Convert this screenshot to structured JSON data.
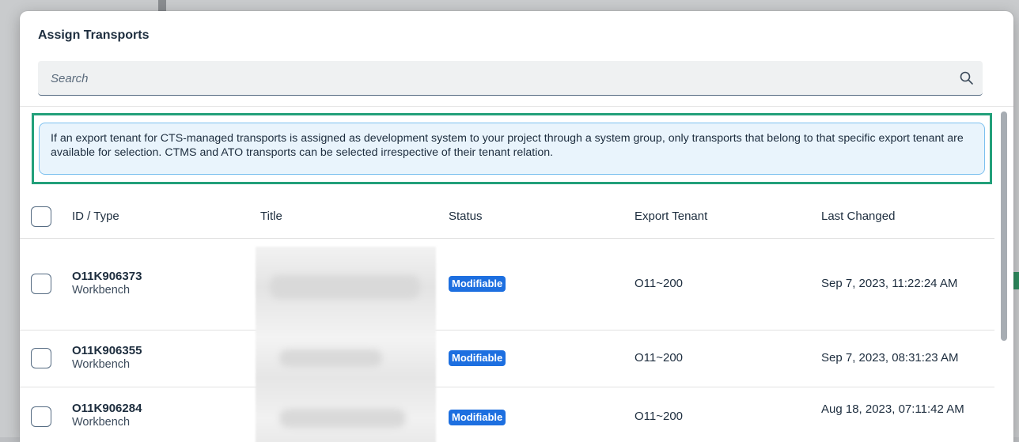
{
  "dialog": {
    "title": "Assign Transports",
    "search_placeholder": "Search"
  },
  "info": {
    "message": "If an export tenant for CTS-managed transports is assigned as development system to your project through a system group, only transports that belong to that specific export tenant are available for selection. CTMS and ATO transports can be selected irrespective of their tenant relation."
  },
  "table": {
    "columns": {
      "id_type": "ID / Type",
      "title": "Title",
      "status": "Status",
      "export_tenant": "Export Tenant",
      "last_changed": "Last Changed"
    },
    "rows": [
      {
        "id": "O11K906373",
        "type": "Workbench",
        "status": "Modifiable",
        "tenant": "O11~200",
        "changed": "Sep 7, 2023, 11:22:24 AM"
      },
      {
        "id": "O11K906355",
        "type": "Workbench",
        "status": "Modifiable",
        "tenant": "O11~200",
        "changed": "Sep 7, 2023, 08:31:23 AM"
      },
      {
        "id": "O11K906284",
        "type": "Workbench",
        "status": "Modifiable",
        "tenant": "O11~200",
        "changed": "Aug 18, 2023, 07:11:42 AM"
      }
    ]
  },
  "colors": {
    "badge": "#1d6fe0",
    "highlight_frame": "#22a07a",
    "info_background": "#e9f4fc"
  }
}
